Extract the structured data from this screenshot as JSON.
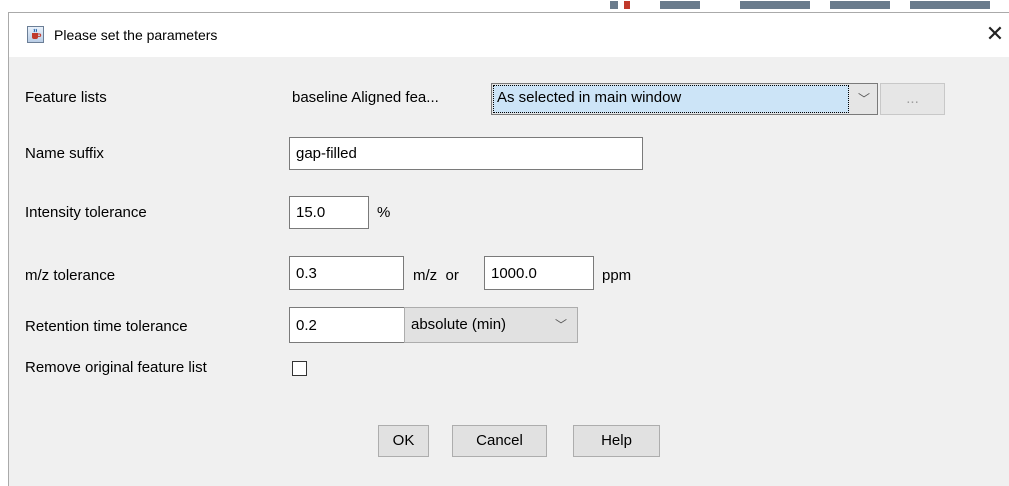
{
  "window": {
    "title": "Please set the parameters",
    "close_glyph": "✕"
  },
  "form": {
    "feature_lists": {
      "label": "Feature lists",
      "selected_list": "baseline Aligned fea...",
      "selection_mode": "As selected in main window",
      "dropdown_glyph": "﹀",
      "browse_label": "..."
    },
    "name_suffix": {
      "label": "Name suffix",
      "value": "gap-filled"
    },
    "intensity_tolerance": {
      "label": "Intensity tolerance",
      "value": "15.0",
      "unit": "%"
    },
    "mz_tolerance": {
      "label": "m/z tolerance",
      "mz_value": "0.3",
      "mz_unit_or": "m/z  or",
      "ppm_value": "1000.0",
      "ppm_unit": "ppm"
    },
    "rt_tolerance": {
      "label": "Retention time tolerance",
      "value": "0.2",
      "mode": "absolute (min)",
      "dropdown_glyph": "﹀"
    },
    "remove_original": {
      "label": "Remove original feature list",
      "checked": false
    }
  },
  "buttons": {
    "ok": "OK",
    "cancel": "Cancel",
    "help": "Help"
  },
  "icons": {
    "app": "java-cup-icon",
    "close": "close-icon",
    "dropdown": "chevron-down-icon"
  }
}
